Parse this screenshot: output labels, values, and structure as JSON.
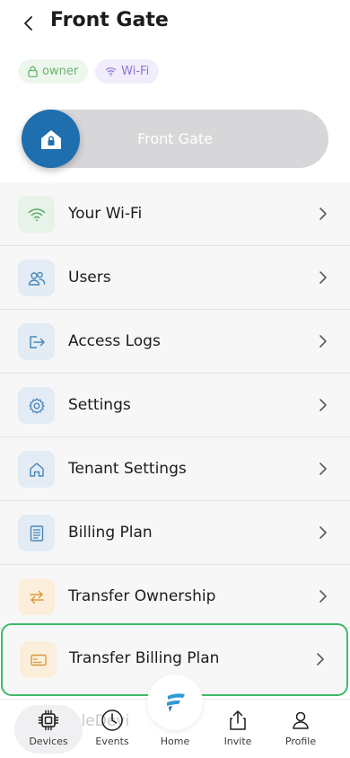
{
  "header": {
    "title": "Front Gate"
  },
  "chips": {
    "owner": "owner",
    "wifi": "Wi-Fi"
  },
  "slider": {
    "label": "Front Gate"
  },
  "menu": [
    {
      "label": "Your Wi-Fi",
      "icon": "wifi-icon"
    },
    {
      "label": "Users",
      "icon": "users-icon"
    },
    {
      "label": "Access Logs",
      "icon": "logout-icon"
    },
    {
      "label": "Settings",
      "icon": "gear-icon"
    },
    {
      "label": "Tenant Settings",
      "icon": "home-icon"
    },
    {
      "label": "Billing Plan",
      "icon": "receipt-icon"
    },
    {
      "label": "Transfer Ownership",
      "icon": "swap-icon"
    },
    {
      "label": "Transfer Billing Plan",
      "icon": "card-icon"
    }
  ],
  "tabbar": {
    "ghost_text": "ScaleDevi",
    "devices": "Devices",
    "events": "Events",
    "home": "Home",
    "invite": "Invite",
    "profile": "Profile"
  },
  "colors": {
    "accent": "#1f6fae",
    "highlight": "#3fba68",
    "owner": "#66b36c",
    "wifi": "#8a74d6"
  }
}
